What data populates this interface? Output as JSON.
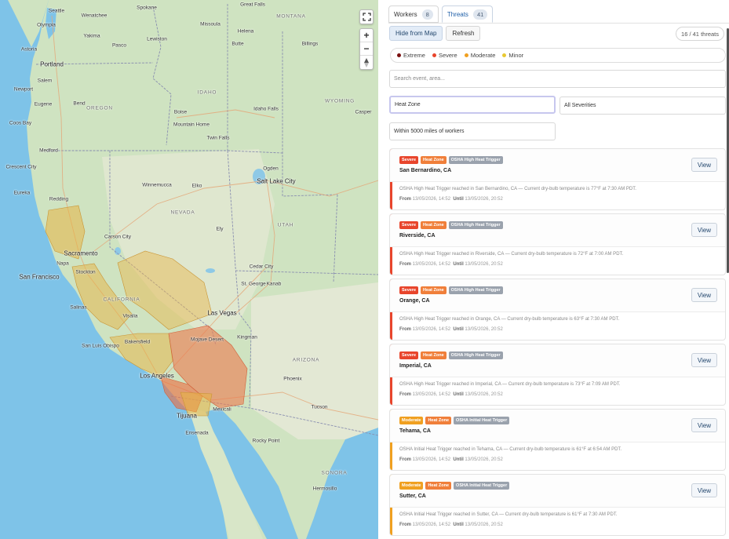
{
  "map": {
    "state_labels": [
      "MONTANA",
      "IDAHO",
      "OREGON",
      "WYOMING",
      "NEVADA",
      "UTAH",
      "CALIFORNIA",
      "ARIZONA",
      "SONORA"
    ],
    "cities": [
      {
        "name": "Seattle"
      },
      {
        "name": "Spokane"
      },
      {
        "name": "Great Falls"
      },
      {
        "name": "Wenatchee"
      },
      {
        "name": "Missoula"
      },
      {
        "name": "Olympia"
      },
      {
        "name": "Yakima"
      },
      {
        "name": "Lewiston"
      },
      {
        "name": "Helena"
      },
      {
        "name": "Astoria"
      },
      {
        "name": "Pasco"
      },
      {
        "name": "Butte"
      },
      {
        "name": "Billings"
      },
      {
        "name": "Portland"
      },
      {
        "name": "Salem"
      },
      {
        "name": "Newport"
      },
      {
        "name": "Eugene"
      },
      {
        "name": "Bend"
      },
      {
        "name": "Boise"
      },
      {
        "name": "Idaho Falls"
      },
      {
        "name": "Casper"
      },
      {
        "name": "Coos Bay"
      },
      {
        "name": "Mountain Home"
      },
      {
        "name": "Twin Falls"
      },
      {
        "name": "Medford"
      },
      {
        "name": "Ogden"
      },
      {
        "name": "Crescent City"
      },
      {
        "name": "Salt Lake City"
      },
      {
        "name": "Eureka"
      },
      {
        "name": "Winnemucca"
      },
      {
        "name": "Elko"
      },
      {
        "name": "Redding"
      },
      {
        "name": "Ely"
      },
      {
        "name": "Carson City"
      },
      {
        "name": "Sacramento"
      },
      {
        "name": "Napa"
      },
      {
        "name": "Stockton"
      },
      {
        "name": "San Francisco"
      },
      {
        "name": "Cedar City"
      },
      {
        "name": "St. George"
      },
      {
        "name": "Kanab"
      },
      {
        "name": "Salinas"
      },
      {
        "name": "Visalia"
      },
      {
        "name": "Las Vegas"
      },
      {
        "name": "San Luis Obispo"
      },
      {
        "name": "Bakersfield"
      },
      {
        "name": "Mojave Desert"
      },
      {
        "name": "Kingman"
      },
      {
        "name": "Los Angeles"
      },
      {
        "name": "Phoenix"
      },
      {
        "name": "Tijuana"
      },
      {
        "name": "Mexicali"
      },
      {
        "name": "Tucson"
      },
      {
        "name": "Ensenada"
      },
      {
        "name": "Rocky Point"
      },
      {
        "name": "Hermosillo"
      }
    ],
    "controls": {
      "fullscreen_icon": "expand-icon",
      "zoom_in": "+",
      "zoom_out": "−",
      "compass_icon": "compass-icon"
    }
  },
  "tabs": [
    {
      "label": "Workers",
      "count": "8",
      "active": false
    },
    {
      "label": "Threats",
      "count": "41",
      "active": true
    }
  ],
  "toolbar": {
    "hide_label": "Hide from Map",
    "refresh_label": "Refresh",
    "counter": "16 / 41 threats"
  },
  "legend": [
    {
      "label": "Extreme",
      "color": "#7a0f0f"
    },
    {
      "label": "Severe",
      "color": "#e8452c"
    },
    {
      "label": "Moderate",
      "color": "#f0a020"
    },
    {
      "label": "Minor",
      "color": "#e8c832"
    }
  ],
  "filters": {
    "search_placeholder": "Search event, area...",
    "event_value": "Heat Zone",
    "severity_value": "All Severities",
    "distance_value": "Within 5000 miles of workers"
  },
  "threats": [
    {
      "severity": "Severe",
      "severity_color": "#e8452c",
      "category": "Heat Zone",
      "trigger": "OSHA High Heat Trigger",
      "location": "San Bernardino, CA",
      "description": "OSHA High Heat Trigger reached in San Bernardino, CA — Current dry-bulb temperature is 77°F at 7:30 AM PDT.",
      "from_label": "From",
      "from": "13/05/2026, 14:52",
      "until_label": "Until",
      "until": "13/05/2026, 20:52",
      "view_label": "View"
    },
    {
      "severity": "Severe",
      "severity_color": "#e8452c",
      "category": "Heat Zone",
      "trigger": "OSHA High Heat Trigger",
      "location": "Riverside, CA",
      "description": "OSHA High Heat Trigger reached in Riverside, CA — Current dry-bulb temperature is 72°F at 7:00 AM PDT.",
      "from_label": "From",
      "from": "13/05/2026, 14:52",
      "until_label": "Until",
      "until": "13/05/2026, 20:52",
      "view_label": "View"
    },
    {
      "severity": "Severe",
      "severity_color": "#e8452c",
      "category": "Heat Zone",
      "trigger": "OSHA High Heat Trigger",
      "location": "Orange, CA",
      "description": "OSHA High Heat Trigger reached in Orange, CA — Current dry-bulb temperature is 63°F at 7:30 AM PDT.",
      "from_label": "From",
      "from": "13/05/2026, 14:52",
      "until_label": "Until",
      "until": "13/05/2026, 20:52",
      "view_label": "View"
    },
    {
      "severity": "Severe",
      "severity_color": "#e8452c",
      "category": "Heat Zone",
      "trigger": "OSHA High Heat Trigger",
      "location": "Imperial, CA",
      "description": "OSHA High Heat Trigger reached in Imperial, CA — Current dry-bulb temperature is 73°F at 7:09 AM PDT.",
      "from_label": "From",
      "from": "13/05/2026, 14:52",
      "until_label": "Until",
      "until": "13/05/2026, 20:52",
      "view_label": "View"
    },
    {
      "severity": "Moderate",
      "severity_color": "#f0a020",
      "category": "Heat Zone",
      "trigger": "OSHA Initial Heat Trigger",
      "location": "Tehama, CA",
      "description": "OSHA Initial Heat Trigger reached in Tehama, CA — Current dry-bulb temperature is 61°F at 6:54 AM PDT.",
      "from_label": "From",
      "from": "13/05/2026, 14:52",
      "until_label": "Until",
      "until": "13/05/2026, 20:52",
      "view_label": "View"
    },
    {
      "severity": "Moderate",
      "severity_color": "#f0a020",
      "category": "Heat Zone",
      "trigger": "OSHA Initial Heat Trigger",
      "location": "Sutter, CA",
      "description": "OSHA Initial Heat Trigger reached in Sutter, CA — Current dry-bulb temperature is 61°F at 7:30 AM PDT.",
      "from_label": "From",
      "from": "13/05/2026, 14:52",
      "until_label": "Until",
      "until": "13/05/2026, 20:52",
      "view_label": "View"
    }
  ]
}
